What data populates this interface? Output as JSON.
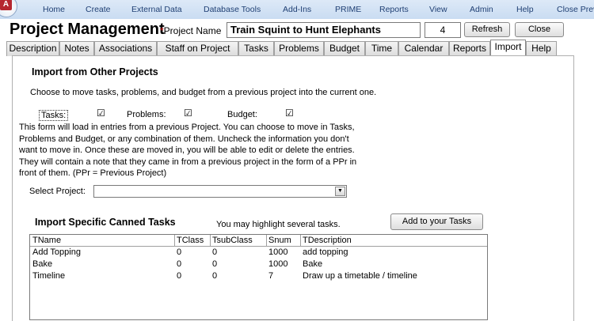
{
  "ribbon": {
    "app_logo_letter": "A",
    "menu": [
      "Home",
      "Create",
      "External Data",
      "Database Tools",
      "Add-Ins",
      "PRIME",
      "Reports",
      "View",
      "Admin",
      "Help",
      "Close Preview"
    ]
  },
  "header": {
    "title": "Project Management",
    "project_name_label": "Project Name",
    "project_name_value": "Train Squint to Hunt Elephants",
    "project_number": "4",
    "refresh_label": "Refresh",
    "close_label": "Close"
  },
  "tabs": [
    {
      "label": "Description",
      "active": false
    },
    {
      "label": "Notes",
      "active": false
    },
    {
      "label": "Associations",
      "active": false
    },
    {
      "label": "Staff on Project",
      "active": false
    },
    {
      "label": "Tasks",
      "active": false
    },
    {
      "label": "Problems",
      "active": false
    },
    {
      "label": "Budget",
      "active": false
    },
    {
      "label": "Time",
      "active": false
    },
    {
      "label": "Calendar",
      "active": false
    },
    {
      "label": "Reports",
      "active": false
    },
    {
      "label": "Import",
      "active": true
    },
    {
      "label": "Help",
      "active": false
    }
  ],
  "import": {
    "heading": "Import from Other Projects",
    "intro": "Choose to move  tasks, problems, and budget from a previous project into the current one.",
    "tasks_label": "Tasks:",
    "problems_label": "Problems:",
    "budget_label": "Budget:",
    "tasks_checked": true,
    "problems_checked": true,
    "budget_checked": true,
    "description": "This form will load in entries from a previous Project. You can choose to move in Tasks, Problems and Budget, or any combination of them. Uncheck the information you don't want to move in. Once these are moved in, you will be able to edit or delete the entries. They will contain a note that they came in from a previous project in the form of a PPr in front of them. (PPr = Previous Project)",
    "select_project_label": "Select Project:",
    "select_project_value": ""
  },
  "canned": {
    "heading": "Import Specific Canned Tasks",
    "hint": "You may highlight several tasks.",
    "add_button_label": "Add to your Tasks",
    "columns": [
      "TName",
      "TClass",
      "TsubClass",
      "Snum",
      "TDescription"
    ],
    "rows": [
      [
        "Add Topping",
        "0",
        "0",
        "1000",
        "add topping"
      ],
      [
        "Bake",
        "0",
        "0",
        "1000",
        "Bake"
      ],
      [
        "Timeline",
        "0",
        "0",
        "7",
        "Draw up a timetable / timeline"
      ]
    ]
  },
  "colors": {
    "ribbon_text": "#1f3f73",
    "required_star": "#c00000",
    "app_logo": "#b5262f"
  }
}
